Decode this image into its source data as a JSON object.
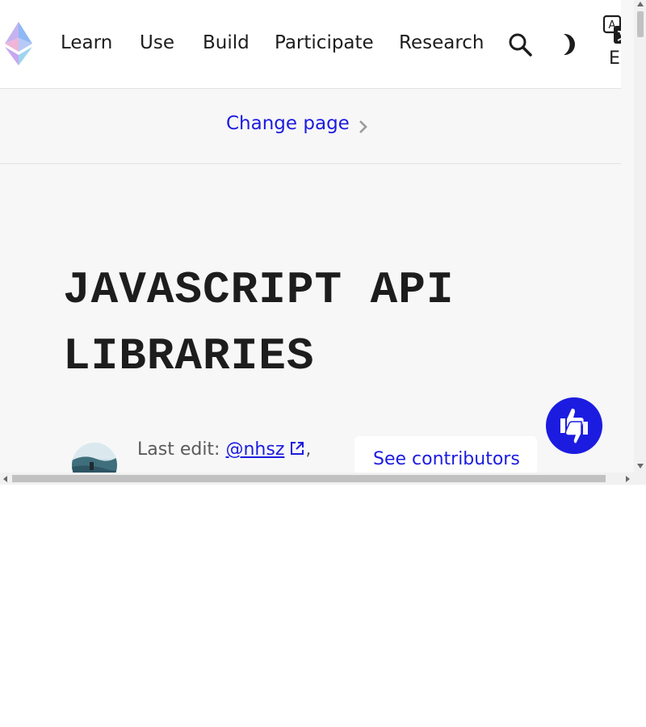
{
  "nav": {
    "items": [
      {
        "label": "Learn"
      },
      {
        "label": "Use"
      },
      {
        "label": "Build"
      },
      {
        "label": "Participate"
      },
      {
        "label": "Research"
      }
    ],
    "language_code": "EN",
    "icons": [
      "ethereum-logo",
      "search-icon",
      "dark-mode-icon",
      "translate-icon"
    ]
  },
  "change_page": {
    "label": "Change page"
  },
  "page": {
    "title": "JAVASCRIPT API LIBRARIES"
  },
  "meta": {
    "last_edit_label": "Last edit:",
    "author": "@nhsz",
    "see_contributors": "See contributors"
  },
  "colors": {
    "accent": "#1c1ce1",
    "text": "#1d1d1d",
    "background": "#f7f7f7"
  }
}
